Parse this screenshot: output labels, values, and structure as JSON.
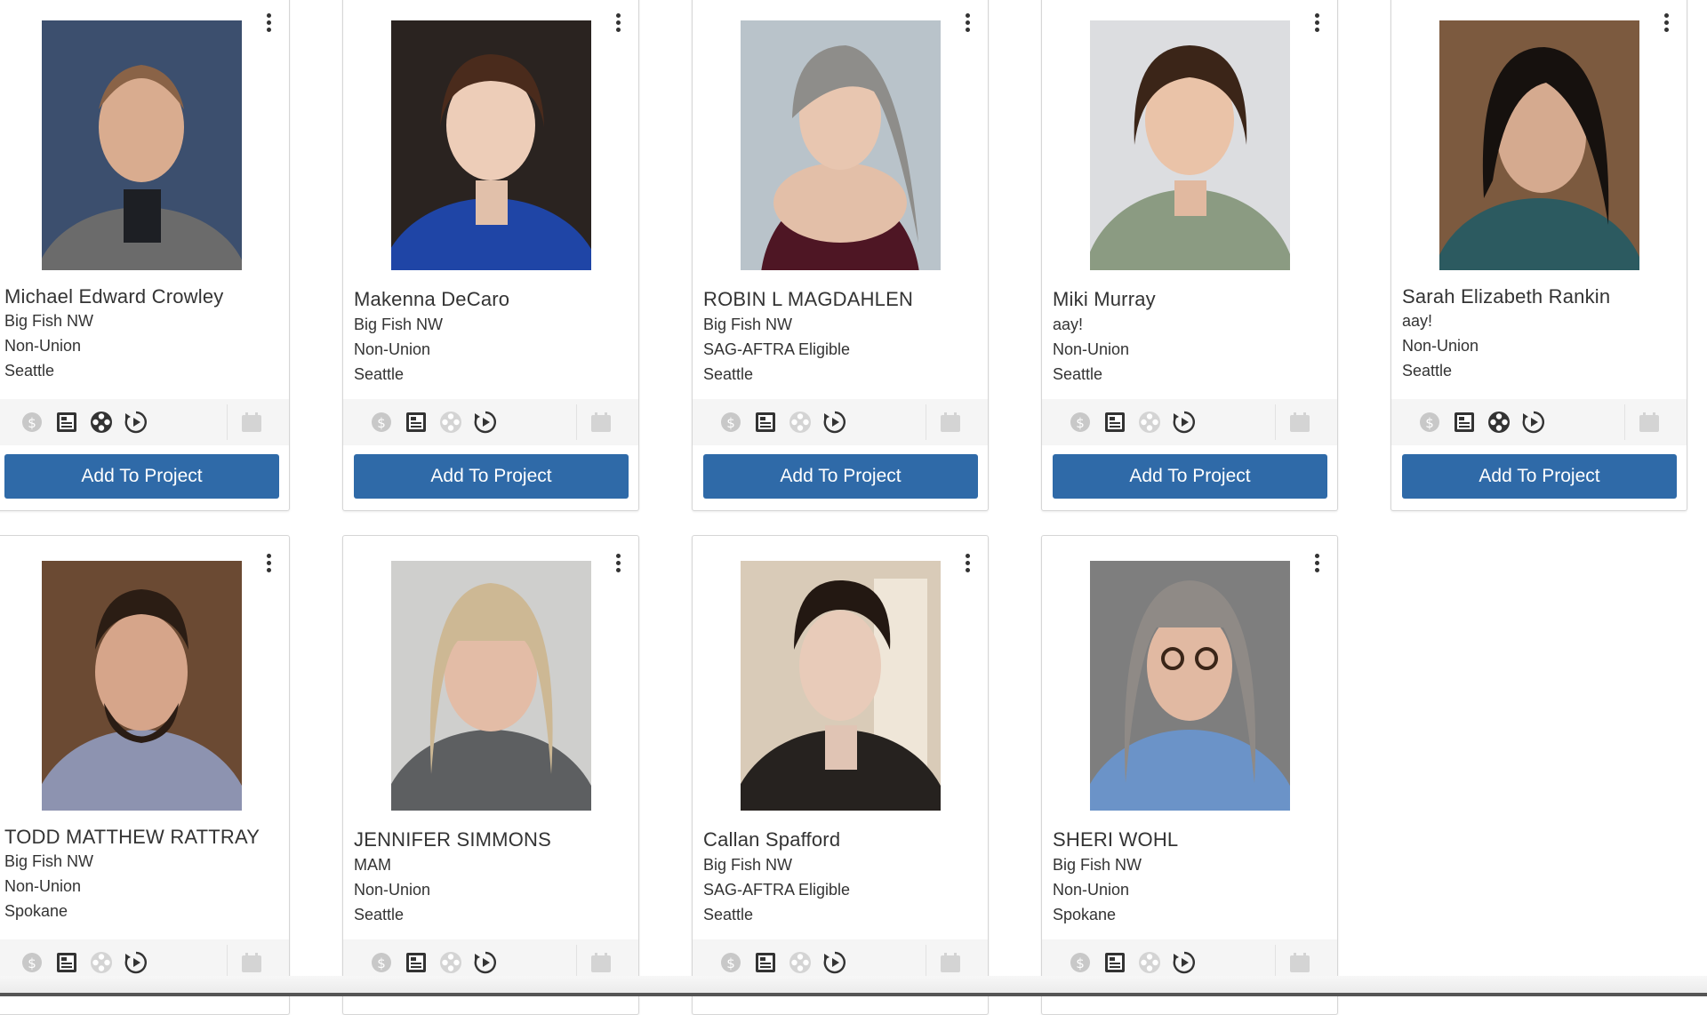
{
  "colors": {
    "button": "#2f6aa8",
    "button_text": "#ffffff",
    "icon_active": "#333333",
    "icon_inactive": "#c8c8c8",
    "card_border": "#d6d6d6",
    "iconbar_bg": "#f5f5f5"
  },
  "button_label": "Add To Project",
  "icons": [
    "dollar-icon",
    "resume-icon",
    "film-reel-icon",
    "play-history-icon",
    "calendar-icon"
  ],
  "talent": [
    {
      "name": "Michael Edward Crowley",
      "agency": "Big Fish NW",
      "union": "Non-Union",
      "city": "Seattle",
      "photo_desc": "headshot",
      "reel_active": true
    },
    {
      "name": "Makenna DeCaro",
      "agency": "Big Fish NW",
      "union": "Non-Union",
      "city": "Seattle",
      "photo_desc": "headshot",
      "reel_active": false
    },
    {
      "name": "ROBIN L MAGDAHLEN",
      "agency": "Big Fish NW",
      "union": "SAG-AFTRA Eligible",
      "city": "Seattle",
      "photo_desc": "headshot",
      "reel_active": false
    },
    {
      "name": "Miki Murray",
      "agency": "aay!",
      "union": "Non-Union",
      "city": "Seattle",
      "photo_desc": "headshot",
      "reel_active": false
    },
    {
      "name": "Sarah Elizabeth Rankin",
      "agency": "aay!",
      "union": "Non-Union",
      "city": "Seattle",
      "photo_desc": "headshot",
      "reel_active": true
    },
    {
      "name": "TODD MATTHEW RATTRAY",
      "agency": "Big Fish NW",
      "union": "Non-Union",
      "city": "Spokane",
      "photo_desc": "headshot",
      "reel_active": false
    },
    {
      "name": "JENNIFER SIMMONS",
      "agency": "MAM",
      "union": "Non-Union",
      "city": "Seattle",
      "photo_desc": "headshot",
      "reel_active": false
    },
    {
      "name": "Callan Spafford",
      "agency": "Big Fish NW",
      "union": "SAG-AFTRA Eligible",
      "city": "Seattle",
      "photo_desc": "headshot",
      "reel_active": false
    },
    {
      "name": "SHERI WOHL",
      "agency": "Big Fish NW",
      "union": "Non-Union",
      "city": "Spokane",
      "photo_desc": "headshot",
      "reel_active": false
    }
  ]
}
